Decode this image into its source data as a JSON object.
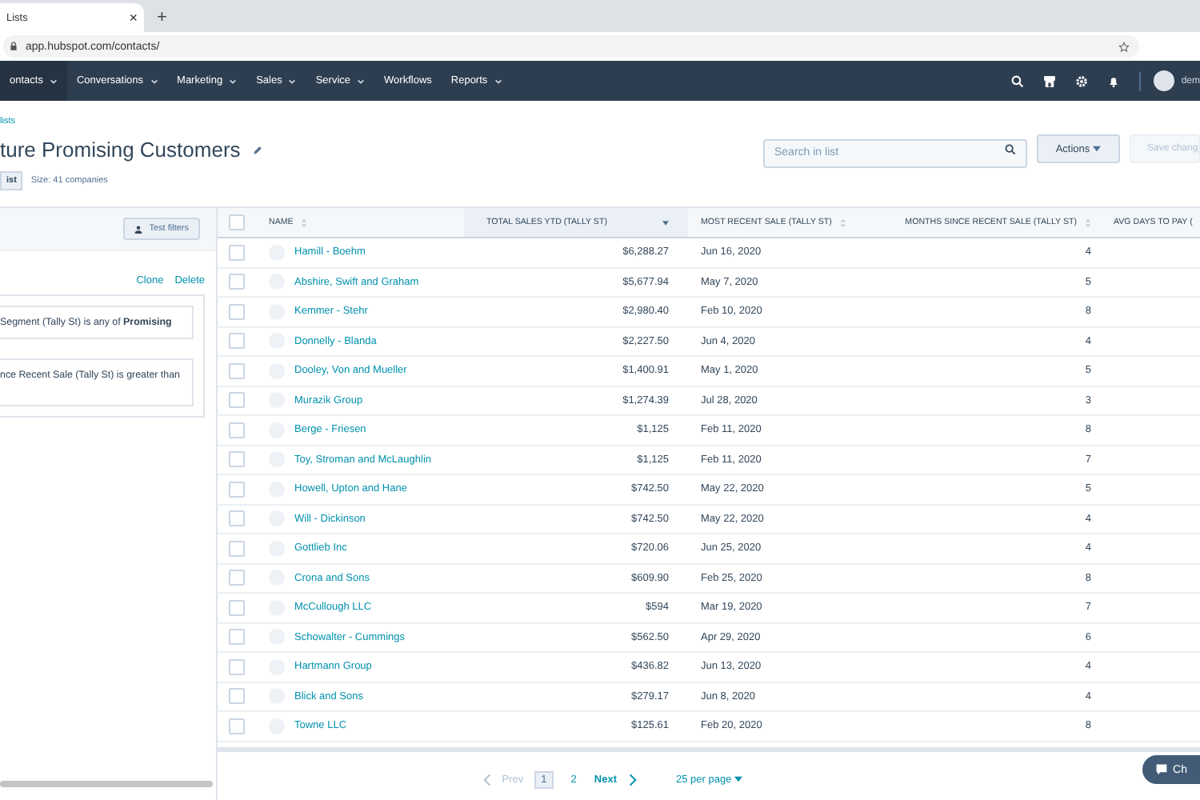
{
  "browser": {
    "tab": {
      "title": "Lists",
      "close": "×",
      "new_tab": "+"
    },
    "address": "app.hubspot.com/contacts/"
  },
  "nav": {
    "items": [
      {
        "label": "ontacts",
        "dropdown": true,
        "selected": true
      },
      {
        "label": "Conversations",
        "dropdown": true,
        "selected": false
      },
      {
        "label": "Marketing",
        "dropdown": true,
        "selected": false
      },
      {
        "label": "Sales",
        "dropdown": true,
        "selected": false
      },
      {
        "label": "Service",
        "dropdown": true,
        "selected": false
      },
      {
        "label": "Workflows",
        "dropdown": false,
        "selected": false
      },
      {
        "label": "Reports",
        "dropdown": true,
        "selected": false
      }
    ],
    "user": "dem"
  },
  "header": {
    "breadcrumb": "lists",
    "title": "ture Promising Customers",
    "list_button": "ist",
    "size": "Size: 41 companies",
    "search": {
      "placeholder": "Search in list"
    },
    "actions": "Actions",
    "save": {
      "label": "Save chang",
      "disabled": true
    }
  },
  "filters": {
    "test_button": "Test filters",
    "clone": "Clone",
    "delete": "Delete",
    "conditions": [
      "Segment (Tally St) is any of **Promising**",
      "nce Recent Sale (Tally St) is greater than"
    ]
  },
  "table": {
    "header_checked": false,
    "columns": [
      {
        "label": "NAME",
        "sorted": false
      },
      {
        "label": "TOTAL SALES YTD (TALLY ST)",
        "sorted": true
      },
      {
        "label": "MOST RECENT SALE (TALLY ST)",
        "sorted": false
      },
      {
        "label": "MONTHS SINCE RECENT SALE (TALLY ST)",
        "sorted": false
      },
      {
        "label": "AVG DAYS TO PAY (",
        "sorted": false
      }
    ],
    "rows": [
      {
        "checked": false,
        "cells": [
          "Hamill - Boehm",
          "$6,288.27",
          "Jun 16, 2020",
          "4"
        ]
      },
      {
        "checked": false,
        "cells": [
          "Abshire, Swift and Graham",
          "$5,677.94",
          "May 7, 2020",
          "5"
        ]
      },
      {
        "checked": false,
        "cells": [
          "Kemmer - Stehr",
          "$2,980.40",
          "Feb 10, 2020",
          "8"
        ]
      },
      {
        "checked": false,
        "cells": [
          "Donnelly - Blanda",
          "$2,227.50",
          "Jun 4, 2020",
          "4"
        ]
      },
      {
        "checked": false,
        "cells": [
          "Dooley, Von and Mueller",
          "$1,400.91",
          "May 1, 2020",
          "5"
        ]
      },
      {
        "checked": false,
        "cells": [
          "Murazik Group",
          "$1,274.39",
          "Jul 28, 2020",
          "3"
        ]
      },
      {
        "checked": false,
        "cells": [
          "Berge - Friesen",
          "$1,125",
          "Feb 11, 2020",
          "8"
        ]
      },
      {
        "checked": false,
        "cells": [
          "Toy, Stroman and McLaughlin",
          "$1,125",
          "Feb 11, 2020",
          "7"
        ]
      },
      {
        "checked": false,
        "cells": [
          "Howell, Upton and Hane",
          "$742.50",
          "May 22, 2020",
          "5"
        ]
      },
      {
        "checked": false,
        "cells": [
          "Will - Dickinson",
          "$742.50",
          "May 22, 2020",
          "4"
        ]
      },
      {
        "checked": false,
        "cells": [
          "Gottlieb Inc",
          "$720.06",
          "Jun 25, 2020",
          "4"
        ]
      },
      {
        "checked": false,
        "cells": [
          "Crona and Sons",
          "$609.90",
          "Feb 25, 2020",
          "8"
        ]
      },
      {
        "checked": false,
        "cells": [
          "McCullough LLC",
          "$594",
          "Mar 19, 2020",
          "7"
        ]
      },
      {
        "checked": false,
        "cells": [
          "Schowalter - Cummings",
          "$562.50",
          "Apr 29, 2020",
          "6"
        ]
      },
      {
        "checked": false,
        "cells": [
          "Hartmann Group",
          "$436.82",
          "Jun 13, 2020",
          "4"
        ]
      },
      {
        "checked": false,
        "cells": [
          "Blick and Sons",
          "$279.17",
          "Jun 8, 2020",
          "4"
        ]
      },
      {
        "checked": false,
        "cells": [
          "Towne LLC",
          "$125.61",
          "Feb 20, 2020",
          "8"
        ]
      }
    ]
  },
  "pagination": {
    "prev": {
      "label": "Prev",
      "disabled": true
    },
    "pages": [
      {
        "label": "1",
        "selected": true
      },
      {
        "label": "2",
        "selected": false
      }
    ],
    "next": {
      "label": "Next",
      "disabled": false
    },
    "per_page": "25 per page"
  },
  "chat": "Ch"
}
